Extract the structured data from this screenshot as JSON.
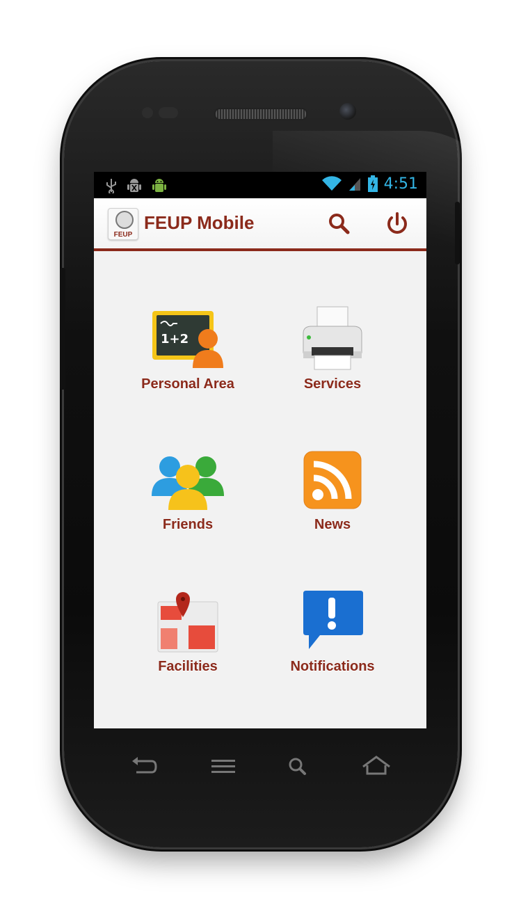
{
  "statusbar": {
    "time": "4:51",
    "icons": [
      "usb-icon",
      "android-debug-icon",
      "android-icon",
      "wifi-icon",
      "signal-icon",
      "battery-charging-icon"
    ]
  },
  "actionbar": {
    "logo_text": "FEUP",
    "title": "FEUP Mobile",
    "search_icon": "search-icon",
    "power_icon": "power-icon"
  },
  "menu": {
    "items": [
      {
        "label": "Personal Area",
        "icon": "chalkboard-person-icon"
      },
      {
        "label": "Services",
        "icon": "printer-icon"
      },
      {
        "label": "Friends",
        "icon": "people-icon"
      },
      {
        "label": "News",
        "icon": "rss-icon"
      },
      {
        "label": "Facilities",
        "icon": "map-pin-icon"
      },
      {
        "label": "Notifications",
        "icon": "exclamation-bubble-icon"
      }
    ]
  },
  "navbar": {
    "keys": [
      "back-icon",
      "menu-icon",
      "search-icon",
      "home-icon"
    ]
  },
  "colors": {
    "brand": "#8b2a1b",
    "status_accent": "#33b5e5",
    "screen_background": "#f2f2f2"
  }
}
